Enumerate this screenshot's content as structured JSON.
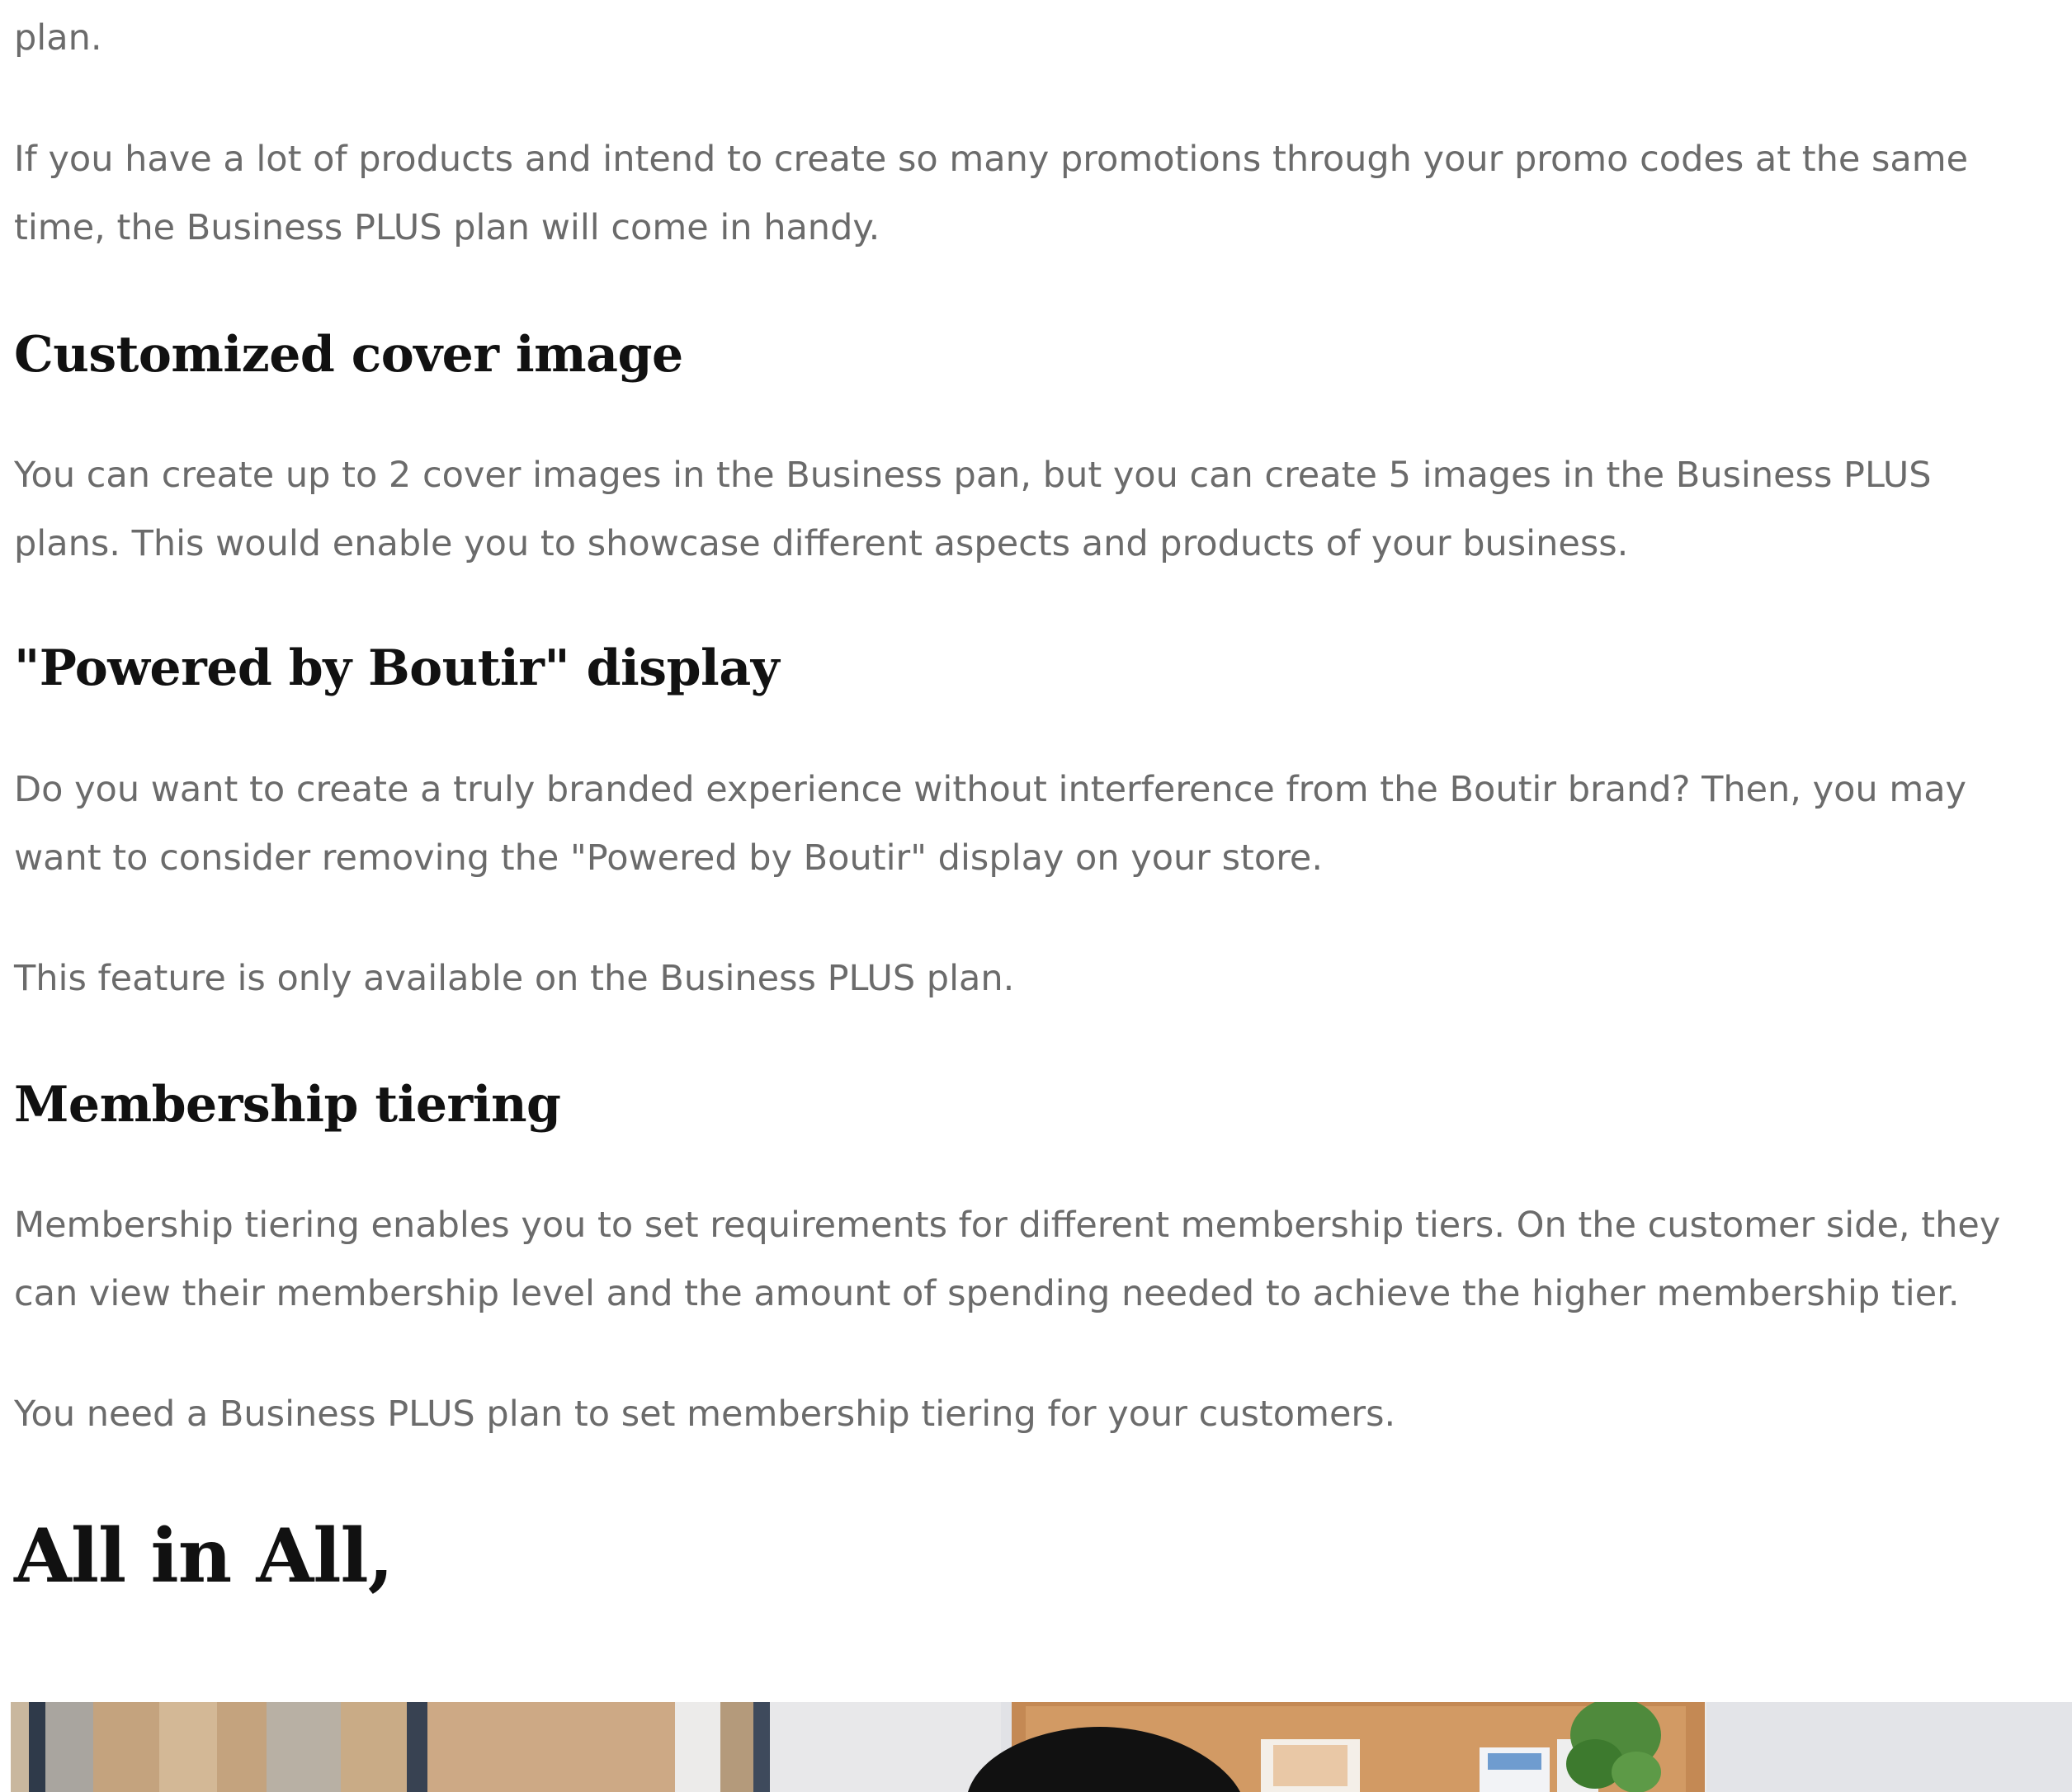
{
  "article": {
    "intro_tail": "plan.",
    "promo_para": {
      "line1": "If you have a lot of products and intend to create so many promotions through your promo codes at the same",
      "line2": "time, the Business PLUS plan will come in handy."
    },
    "sections": [
      {
        "heading": "Customized cover image",
        "paras": [
          {
            "line1": "You can create up to 2 cover images in the Business pan, but you can create 5 images in the Business PLUS",
            "line2": "plans. This would enable you to showcase different aspects and products of your business."
          }
        ]
      },
      {
        "heading": "\"Powered by Boutir\" display",
        "paras": [
          {
            "line1": "Do you want to create a truly branded experience without interference from the Boutir brand? Then, you may",
            "line2": "want to consider removing the \"Powered by Boutir\" display on your store."
          },
          {
            "line1": "This feature is only available on the Business PLUS plan."
          }
        ]
      },
      {
        "heading": "Membership tiering",
        "paras": [
          {
            "line1": "Membership tiering enables you to set requirements for different membership tiers. On the customer side, they",
            "line2": "can view their membership level and the amount of spending needed to achieve the higher membership tier."
          },
          {
            "line1": "You need a Business PLUS plan to set membership tiering for your customers."
          }
        ]
      }
    ],
    "conclusion_heading": "All in All,"
  },
  "colors": {
    "body_text": "#6b6b6b",
    "heading_text": "#111111",
    "background": "#ffffff"
  }
}
